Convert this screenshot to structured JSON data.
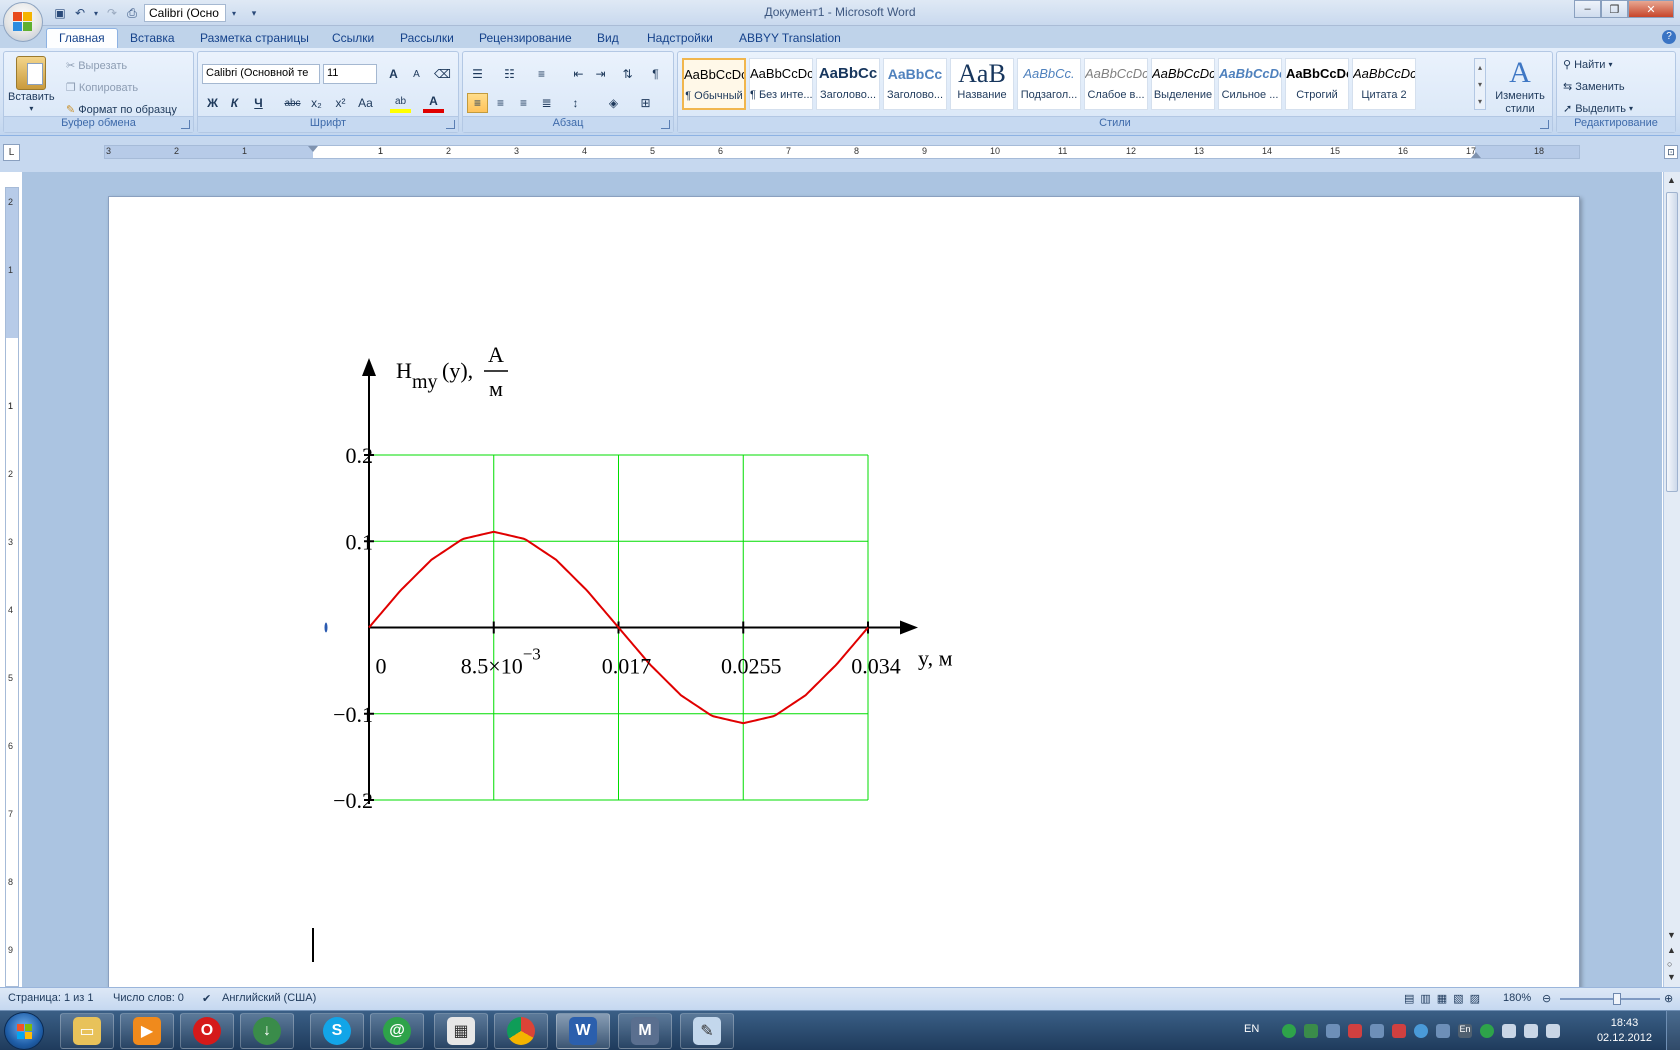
{
  "window": {
    "title": "Документ1 - Microsoft Word",
    "qat_font": "Calibri (Осно",
    "controls": [
      "–",
      "❐",
      "✕"
    ]
  },
  "tabs": [
    "Главная",
    "Вставка",
    "Разметка страницы",
    "Ссылки",
    "Рассылки",
    "Рецензирование",
    "Вид",
    "Надстройки",
    "ABBYY Translation"
  ],
  "ribbon": {
    "clipboard": {
      "label": "Буфер обмена",
      "paste": "Вставить",
      "cut": "Вырезать",
      "copy": "Копировать",
      "format_painter": "Формат по образцу"
    },
    "font": {
      "label": "Шрифт",
      "font_name": "Calibri (Основной те",
      "font_size": "11",
      "grow": "A",
      "shrink": "A",
      "bold": "Ж",
      "italic": "К",
      "underline": "Ч",
      "strike": "abc",
      "subscript": "x₂",
      "superscript": "x²",
      "case": "Aa",
      "highlight": "ab",
      "font_color": "A"
    },
    "paragraph": {
      "label": "Абзац"
    },
    "styles": {
      "label": "Стили",
      "change_styles": "Изменить стили",
      "items": [
        {
          "preview": "AaBbCcDc",
          "caption": "¶ Обычный"
        },
        {
          "preview": "AaBbCcDc",
          "caption": "¶ Без инте..."
        },
        {
          "preview": "AaBbCc",
          "caption": "Заголово..."
        },
        {
          "preview": "AaBbCc",
          "caption": "Заголово..."
        },
        {
          "preview": "AaB",
          "caption": "Название"
        },
        {
          "preview": "AaBbCc.",
          "caption": "Подзагол..."
        },
        {
          "preview": "AaBbCcDc",
          "caption": "Слабое в..."
        },
        {
          "preview": "AaBbCcDc",
          "caption": "Выделение"
        },
        {
          "preview": "AaBbCcDc",
          "caption": "Сильное ..."
        },
        {
          "preview": "AaBbCcDc",
          "caption": "Строгий"
        },
        {
          "preview": "AaBbCcDc",
          "caption": "Цитата 2"
        }
      ]
    },
    "editing": {
      "label": "Редактирование",
      "find": "Найти",
      "replace": "Заменить",
      "select": "Выделить"
    }
  },
  "ruler": {
    "h_numbers": [
      "3",
      "2",
      "1",
      "1",
      "1",
      "2",
      "3",
      "4",
      "5",
      "6",
      "7",
      "8",
      "9",
      "10",
      "11",
      "12",
      "13",
      "14",
      "15",
      "16",
      "17",
      "18"
    ],
    "v_numbers": [
      "2",
      "1",
      "1",
      "1",
      "2",
      "3",
      "4",
      "5",
      "6",
      "7",
      "8",
      "9"
    ]
  },
  "chart_data": {
    "type": "line",
    "ylabel_main": "H",
    "ylabel_sub": "my",
    "ylabel_arg": "(y),",
    "ylabel_unit_num": "A",
    "ylabel_unit_den": "м",
    "xlabel": "y, м",
    "x_ticks": [
      "0",
      "8.5×10",
      "0.017",
      "0.0255",
      "0.034"
    ],
    "x_tick_exp": "−3",
    "y_ticks": [
      "0.2",
      "0.1",
      "−0.1",
      "−0.2"
    ],
    "xlim": [
      0,
      0.034
    ],
    "ylim": [
      -0.2,
      0.2
    ],
    "grid": true,
    "grid_color": "#00dd00",
    "line_color": "#e00000",
    "series": [
      {
        "x": [
          0,
          0.002125,
          0.00425,
          0.006375,
          0.0085,
          0.010625,
          0.01275,
          0.014875,
          0.017,
          0.019125,
          0.02125,
          0.023375,
          0.0255,
          0.027625,
          0.02975,
          0.031875,
          0.034
        ],
        "y": [
          0,
          0.0425,
          0.0785,
          0.1026,
          0.111,
          0.1026,
          0.0785,
          0.0425,
          0,
          -0.0425,
          -0.0785,
          -0.1026,
          -0.111,
          -0.1026,
          -0.0785,
          -0.0425,
          0
        ]
      }
    ]
  },
  "status": {
    "page": "Страница: 1 из 1",
    "words": "Число слов: 0",
    "language": "Английский (США)",
    "zoom": "180%"
  },
  "taskbar": {
    "lang": "EN",
    "time": "18:43",
    "date": "02.12.2012"
  }
}
